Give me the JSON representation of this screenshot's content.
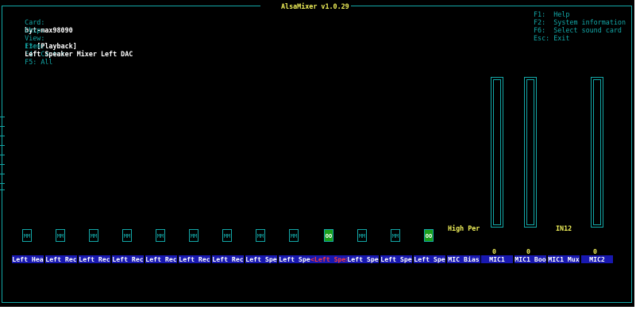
{
  "window": {
    "title": "AlsaMixer v1.0.29"
  },
  "info": {
    "card_label": "Card:",
    "card_value": "byt-max98090",
    "chip_label": "Chip:",
    "view_label": "View:",
    "view_f3": "F3:",
    "view_playback": "[Playback]",
    "view_f4": "F4: Capture",
    "view_f5": "F5: All",
    "item_label": "Item:",
    "item_value": "Left Speaker Mixer Left DAC"
  },
  "help": [
    {
      "key": "F1:",
      "text": "Help"
    },
    {
      "key": "F2:",
      "text": "System information"
    },
    {
      "key": "F6:",
      "text": "Select sound card"
    },
    {
      "key": "Esc:",
      "text": "Exit"
    }
  ],
  "controls": [
    {
      "label": "Left Hea",
      "mute": "MM"
    },
    {
      "label": "Left Rec",
      "mute": "MM"
    },
    {
      "label": "Left Rec",
      "mute": "MM"
    },
    {
      "label": "Left Rec",
      "mute": "MM"
    },
    {
      "label": "Left Rec",
      "mute": "MM"
    },
    {
      "label": "Left Rec",
      "mute": "MM"
    },
    {
      "label": "Left Rec",
      "mute": "MM"
    },
    {
      "label": "Left Spe",
      "mute": "MM"
    },
    {
      "label": "Left Spe",
      "mute": "MM"
    },
    {
      "label": "<Left Spe>",
      "mute": "OO",
      "selected": true
    },
    {
      "label": "Left Spe",
      "mute": "MM"
    },
    {
      "label": "Left Spe",
      "mute": "MM"
    },
    {
      "label": "Left Spe",
      "mute": "OO"
    },
    {
      "label": "MIC Bias",
      "enum_value": "High Per"
    },
    {
      "label": "MIC1",
      "value": "0",
      "level": 0
    },
    {
      "label": "MIC1 Boo",
      "value": "0",
      "level": 0
    },
    {
      "label": "MIC1 Mux",
      "enum_value": "IN12"
    },
    {
      "label": "MIC2",
      "value": "0",
      "level": 0
    }
  ],
  "colors": {
    "frame": "#13a8a8",
    "highlight": "#f2f25a",
    "label_bg": "#1818b0",
    "active_mute": "#1a9e1a",
    "selected_label": "#ff3b3b"
  }
}
